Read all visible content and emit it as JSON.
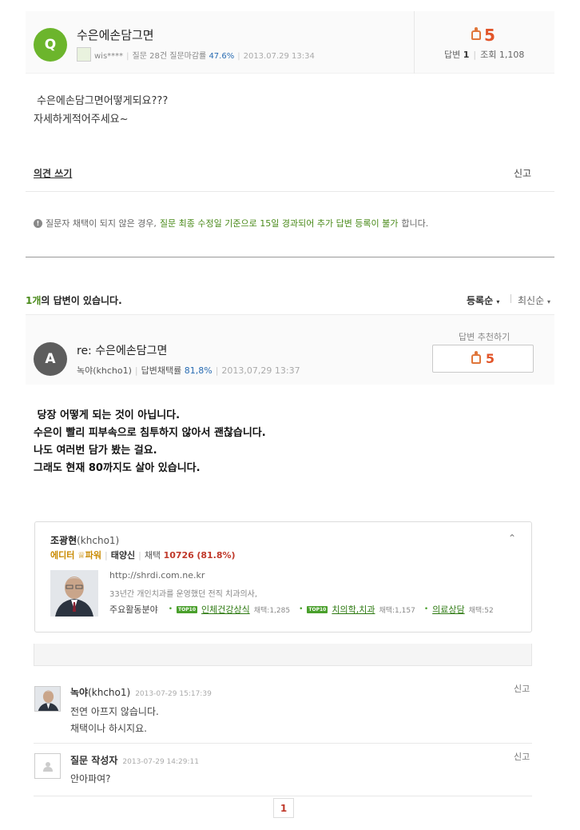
{
  "question": {
    "badge": "Q",
    "title": "수은에손담그면",
    "user": "wis****",
    "question_stat": "질문 28건",
    "close_rate_label": "질문마감률",
    "close_rate": "47.6%",
    "date": "2013.07.29 13:34",
    "recommend": "5",
    "answers_label": "답변",
    "answers": "1",
    "views_label": "조회",
    "views": "1,108",
    "body_line1": "수은에손담그면어떻게되요???",
    "body_line2": "자세하게적어주세요~",
    "opinion_link": "의견 쓰기",
    "report": "신고",
    "notice_pre": "질문자 채택이 되지 않은 경우, ",
    "notice_green": "질문 최종 수정일 기준으로 15일 경과되어 추가 답변 등록이 불가",
    "notice_post": "합니다.",
    "info_icon": "info-icon"
  },
  "answers_section": {
    "count": "1개",
    "count_suffix": "의 답변이 있습니다.",
    "sort_registered": "등록순",
    "sort_latest": "최신순"
  },
  "answer": {
    "badge": "A",
    "title": "re: 수은에손담그면",
    "author": "녹야(khcho1)",
    "adopt_label": "답변채택률",
    "adopt_rate": "81,8%",
    "date": "2013,07,29 13:37",
    "recommend_label": "답변 추천하기",
    "recommend": "5",
    "body": " 당장 어떻게 되는 것이 아닙니다.\n수은이 빨리 피부속으로 침투하지 않아서 괜찮습니다.\n나도 여러번 담가 봤는 걸요.\n그래도 현재 80까지도 살아 있습니다."
  },
  "profile": {
    "name": "조광현",
    "id": "(khcho1)",
    "grade": "에디터",
    "power": "파워",
    "rank": "태양신",
    "adopt_label": "채택",
    "adopt_value": "10726",
    "adopt_pct": "(81.8%)",
    "url": "http://shrdi.com.ne.kr",
    "desc": "33년간 개인치과를 운영했던 전직 치과의사,",
    "areas_label": "주요활동분야",
    "areas": [
      {
        "badge": "TOP10",
        "name": "인체건강상식",
        "count": "채택:1,285"
      },
      {
        "badge": "TOP10",
        "name": "치의학,치과",
        "count": "채택:1,157"
      },
      {
        "badge": "",
        "name": "의료상담",
        "count": "채택:52"
      }
    ]
  },
  "comments": [
    {
      "author": "녹야",
      "id": "(khcho1)",
      "date": "2013-07-29 15:17:39",
      "line1": "전연 아프지 않습니다.",
      "line2": "채택이나 하시지요.",
      "report": "신고"
    },
    {
      "author": "질문 작성자",
      "date": "2013-07-29 14:29:11",
      "line1": "안아파여?",
      "report": "신고"
    }
  ],
  "pagination": {
    "current": "1"
  },
  "colors": {
    "green": "#4a8a1a",
    "red": "#e2552a",
    "blue": "#2a6db3"
  }
}
